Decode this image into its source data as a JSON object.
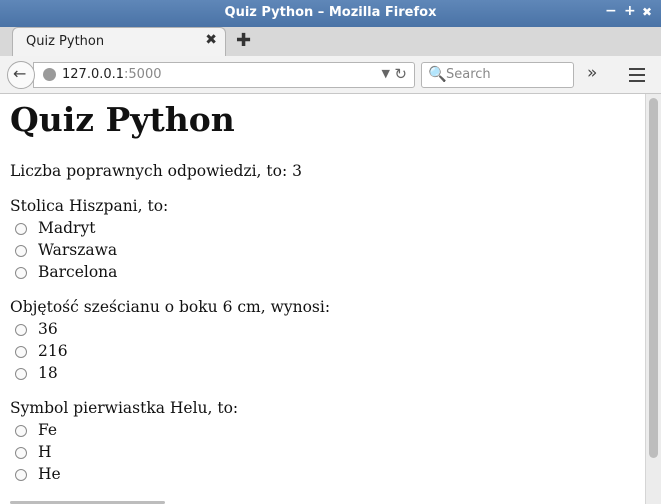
{
  "window": {
    "title": "Quiz Python – Mozilla Firefox",
    "minimize_glyph": "−",
    "maximize_glyph": "+",
    "close_glyph": "✖"
  },
  "tab": {
    "label": "Quiz Python",
    "close_glyph": "✖",
    "new_tab_glyph": "✚"
  },
  "navbar": {
    "back_glyph": "←",
    "url_host": "127.0.0.1",
    "url_port": ":5000",
    "dropdown_glyph": "▼",
    "reload_glyph": "↻",
    "search_placeholder": "Search",
    "search_glyph": "🔍",
    "overflow_glyph": "»"
  },
  "page": {
    "heading": "Quiz Python",
    "result_text": "Liczba poprawnych odpowiedzi, to: 3",
    "questions": [
      {
        "text": "Stolica Hiszpani, to:",
        "options": [
          "Madryt",
          "Warszawa",
          "Barcelona"
        ]
      },
      {
        "text": "Objętość sześcianu o boku 6 cm, wynosi:",
        "options": [
          "36",
          "216",
          "18"
        ]
      },
      {
        "text": "Symbol pierwiastka Helu, to:",
        "options": [
          "Fe",
          "H",
          "He"
        ]
      }
    ]
  }
}
